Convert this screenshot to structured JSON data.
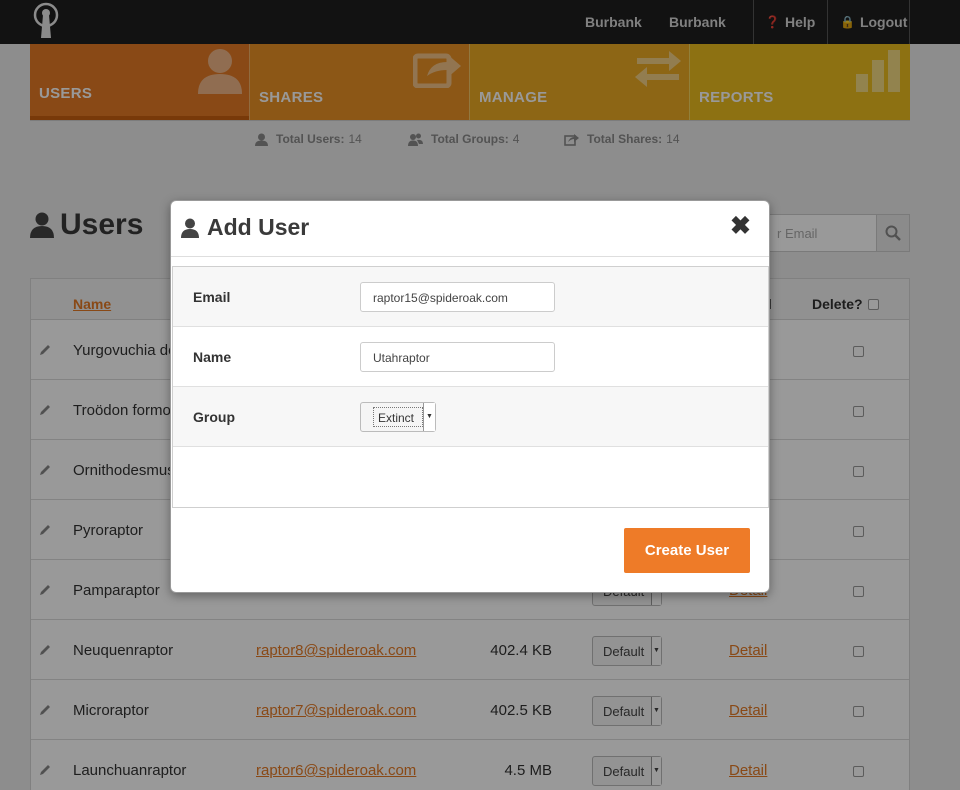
{
  "topbar": {
    "user_first": "Burbank",
    "user_last": "Burbank",
    "help": "Help",
    "logout": "Logout"
  },
  "tabs": [
    {
      "label": "USERS",
      "icon": "user-icon",
      "active": true
    },
    {
      "label": "SHARES",
      "icon": "share-icon",
      "active": false
    },
    {
      "label": "MANAGE",
      "icon": "arrows-exchange-icon",
      "active": false
    },
    {
      "label": "REPORTS",
      "icon": "bar-chart-icon",
      "active": false
    }
  ],
  "stats": {
    "users_label": "Total Users:",
    "users_value": "14",
    "groups_label": "Total Groups:",
    "groups_value": "4",
    "shares_label": "Total Shares:",
    "shares_value": "14"
  },
  "page": {
    "title": "Users",
    "search_placeholder": "r Email"
  },
  "table": {
    "col_name": "Name",
    "col_detail": "il",
    "col_delete": "Delete?",
    "rows": [
      {
        "name": "Yurgovuchia do",
        "email": "",
        "size": "",
        "group": "",
        "detail": ""
      },
      {
        "name": "Troödon formo",
        "email": "",
        "size": "",
        "group": "",
        "detail": ""
      },
      {
        "name": "Ornithodesmus",
        "email": "",
        "size": "",
        "group": "",
        "detail": ""
      },
      {
        "name": "Pyroraptor",
        "email": "",
        "size": "",
        "group": "",
        "detail": ""
      },
      {
        "name": "Pamparaptor",
        "email": "",
        "size": "",
        "group": "Default",
        "detail": "Detail"
      },
      {
        "name": "Neuquenraptor",
        "email": "raptor8@spideroak.com",
        "size": "402.4 KB",
        "group": "Default",
        "detail": "Detail"
      },
      {
        "name": "Microraptor",
        "email": "raptor7@spideroak.com",
        "size": "402.5 KB",
        "group": "Default",
        "detail": "Detail"
      },
      {
        "name": "Launchuanraptor",
        "email": "raptor6@spideroak.com",
        "size": "4.5 MB",
        "group": "Default",
        "detail": "Detail"
      }
    ]
  },
  "modal": {
    "title": "Add User",
    "close": "✖",
    "email_label": "Email",
    "email_value": "raptor15@spideroak.com",
    "name_label": "Name",
    "name_value": "Utahraptor",
    "group_label": "Group",
    "group_value": "Extinct",
    "create_button": "Create User"
  },
  "colors": {
    "accent": "#ee7b28",
    "tab_users": "#e57b26",
    "tab_shares": "#ea9226",
    "tab_manage": "#ecab23",
    "tab_reports": "#ecbd1e"
  }
}
